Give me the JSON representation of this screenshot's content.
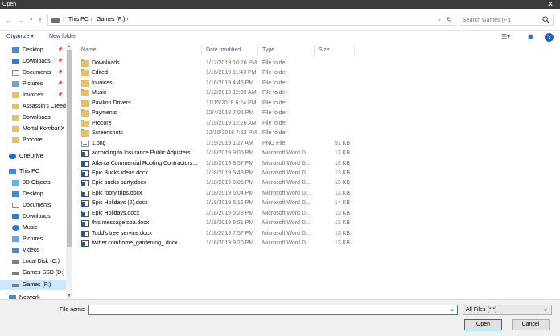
{
  "window": {
    "title": "Open",
    "close_glyph": "✕"
  },
  "address_bar": {
    "segments": [
      "This PC",
      "Games (F:)"
    ],
    "search_placeholder": "Search Games (F:)"
  },
  "toolbar": {
    "organize": "Organize ▾",
    "new_folder": "New folder"
  },
  "nav": [
    {
      "label": "Desktop",
      "icon": "desktop-icon",
      "pinned": true
    },
    {
      "label": "Downloads",
      "icon": "downloads-icon",
      "pinned": true
    },
    {
      "label": "Documents",
      "icon": "documents-icon",
      "pinned": true
    },
    {
      "label": "Pictures",
      "icon": "pictures-icon",
      "pinned": true
    },
    {
      "label": "Invoices",
      "icon": "folder-icon",
      "pinned": true
    },
    {
      "label": "Assassin's Creed",
      "icon": "folder-icon",
      "pinned": false
    },
    {
      "label": "Downloads",
      "icon": "folder-icon",
      "pinned": false
    },
    {
      "label": "Mortal Kombat X",
      "icon": "folder-icon",
      "pinned": false
    },
    {
      "label": "Procore",
      "icon": "folder-icon",
      "pinned": false
    },
    {
      "label": "OneDrive",
      "icon": "cloud-icon",
      "pinned": false
    },
    {
      "label": "This PC",
      "icon": "computer-icon",
      "pinned": false
    },
    {
      "label": "3D Objects",
      "icon": "3d-objects-icon",
      "pinned": false
    },
    {
      "label": "Desktop",
      "icon": "desktop-icon",
      "pinned": false
    },
    {
      "label": "Documents",
      "icon": "documents-icon",
      "pinned": false
    },
    {
      "label": "Downloads",
      "icon": "downloads-icon",
      "pinned": false
    },
    {
      "label": "Music",
      "icon": "music-icon",
      "pinned": false
    },
    {
      "label": "Pictures",
      "icon": "pictures-icon",
      "pinned": false
    },
    {
      "label": "Videos",
      "icon": "videos-icon",
      "pinned": false
    },
    {
      "label": "Local Disk (C:)",
      "icon": "drive-icon",
      "pinned": false
    },
    {
      "label": "Games SSD (D:)",
      "icon": "drive-icon",
      "pinned": false
    },
    {
      "label": "Games (F:)",
      "icon": "drive-icon",
      "pinned": false,
      "selected": true
    },
    {
      "label": "Network",
      "icon": "network-icon",
      "pinned": false
    }
  ],
  "columns": {
    "name": "Name",
    "date": "Date modified",
    "type": "Type",
    "size": "Size"
  },
  "files": [
    {
      "name": "Downloads",
      "date": "1/17/2019 10:26 PM",
      "type": "File folder",
      "size": "",
      "kind": "folder"
    },
    {
      "name": "Edited",
      "date": "1/16/2019 11:43 PM",
      "type": "File folder",
      "size": "",
      "kind": "folder"
    },
    {
      "name": "Invoices",
      "date": "1/16/2019 4:45 PM",
      "type": "File folder",
      "size": "",
      "kind": "folder"
    },
    {
      "name": "Music",
      "date": "1/12/2019 12:09 AM",
      "type": "File folder",
      "size": "",
      "kind": "folder"
    },
    {
      "name": "Pavilion Drivers",
      "date": "11/15/2018 6:24 PM",
      "type": "File folder",
      "size": "",
      "kind": "folder"
    },
    {
      "name": "Payments",
      "date": "12/4/2018 7:05 PM",
      "type": "File folder",
      "size": "",
      "kind": "folder"
    },
    {
      "name": "Procore",
      "date": "1/19/2019 12:26 AM",
      "type": "File folder",
      "size": "",
      "kind": "folder"
    },
    {
      "name": "Screenshots",
      "date": "12/10/2018 7:52 PM",
      "type": "File folder",
      "size": "",
      "kind": "folder"
    },
    {
      "name": "1.png",
      "date": "1/19/2019 1:27 AM",
      "type": "PNG File",
      "size": "51 KB",
      "kind": "png"
    },
    {
      "name": "according to Insurance Public Adjusters ...",
      "date": "1/18/2019 9:05 PM",
      "type": "Microsoft Word D...",
      "size": "13 KB",
      "kind": "docx"
    },
    {
      "name": "Atlanta Commercial Roofing Contractors...",
      "date": "1/18/2019 8:57 PM",
      "type": "Microsoft Word D...",
      "size": "13 KB",
      "kind": "docx"
    },
    {
      "name": "Epic Bucks ideas.docx",
      "date": "1/18/2019 5:43 PM",
      "type": "Microsoft Word D...",
      "size": "13 KB",
      "kind": "docx"
    },
    {
      "name": "Epic bucks party.docx",
      "date": "1/18/2019 5:05 PM",
      "type": "Microsoft Word D...",
      "size": "13 KB",
      "kind": "docx"
    },
    {
      "name": "Epic footy trips.docx",
      "date": "1/18/2019 6:04 PM",
      "type": "Microsoft Word D...",
      "size": "13 KB",
      "kind": "docx"
    },
    {
      "name": "Epic Holidays (2).docx",
      "date": "1/18/2019 6:16 PM",
      "type": "Microsoft Word D...",
      "size": "14 KB",
      "kind": "docx"
    },
    {
      "name": "Epic Holidays.docx",
      "date": "1/18/2019 5:28 PM",
      "type": "Microsoft Word D...",
      "size": "13 KB",
      "kind": "docx"
    },
    {
      "name": "this message spa.docx",
      "date": "1/18/2019 8:51 PM",
      "type": "Microsoft Word D...",
      "size": "13 KB",
      "kind": "docx"
    },
    {
      "name": "Todd's tree service.docx",
      "date": "1/18/2019 7:57 PM",
      "type": "Microsoft Word D...",
      "size": "13 KB",
      "kind": "docx"
    },
    {
      "name": "twitter.comhome_gardening_.docx",
      "date": "1/18/2019 9:20 PM",
      "type": "Microsoft Word D...",
      "size": "13 KB",
      "kind": "docx"
    }
  ],
  "bottom": {
    "filename_label": "File name:",
    "filename_value": "",
    "filetype": "All Files (*.*)",
    "open_label": "Open",
    "cancel_label": "Cancel"
  },
  "colors": {
    "accent": "#0078d7",
    "selection": "#cce8ff",
    "folder": "#e8c05c",
    "word": "#2b579a"
  }
}
